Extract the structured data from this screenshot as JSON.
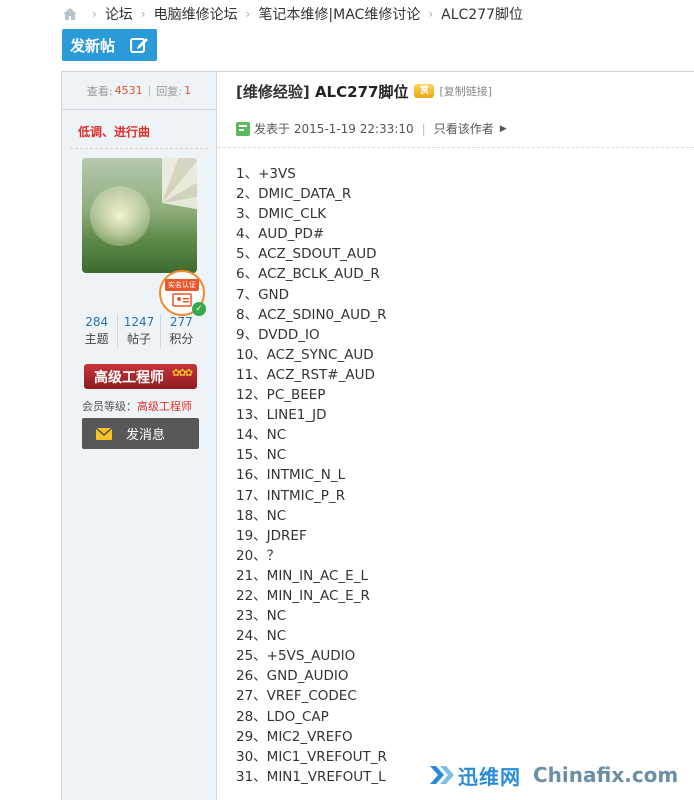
{
  "breadcrumb": {
    "items": [
      "论坛",
      "电脑维修论坛",
      "笔记本维修|MAC维修讨论",
      "ALC277脚位"
    ]
  },
  "toolbar": {
    "new_post_label": "发新帖"
  },
  "stats": {
    "views_label": "查看:",
    "views": "4531",
    "replies_label": "回复:",
    "replies": "1"
  },
  "author": {
    "name": "低调、进行曲",
    "cert_label": "实名认证",
    "counts": [
      {
        "value": "284",
        "label": "主题"
      },
      {
        "value": "1247",
        "label": "帖子"
      },
      {
        "value": "277",
        "label": "积分"
      }
    ],
    "rank": "高级工程师",
    "member_level_label": "会员等级：",
    "member_level": "高级工程师",
    "message_label": "发消息"
  },
  "post": {
    "category": "[维修经验]",
    "title": "ALC277脚位",
    "coin_icon_text": "赏",
    "copy_link": "[复制链接]",
    "posted_at": "发表于 2015-1-19 22:33:10",
    "author_only": "只看该作者",
    "pins": [
      "1、+3VS",
      "2、DMIC_DATA_R",
      "3、DMIC_CLK",
      "4、AUD_PD#",
      "5、ACZ_SDOUT_AUD",
      "6、ACZ_BCLK_AUD_R",
      "7、GND",
      "8、ACZ_SDIN0_AUD_R",
      "9、DVDD_IO",
      "10、ACZ_SYNC_AUD",
      "11、ACZ_RST#_AUD",
      "12、PC_BEEP",
      "13、LINE1_JD",
      "14、NC",
      "15、NC",
      "16、INTMIC_N_L",
      "17、INTMIC_P_R",
      "18、NC",
      "19、JDREF",
      "20、？",
      "21、MIN_IN_AC_E_L",
      "22、MIN_IN_AC_E_R",
      "23、NC",
      "24、NC",
      "25、+5VS_AUDIO",
      "26、GND_AUDIO",
      "27、VREF_CODEC",
      "28、LDO_CAP",
      "29、MIC2_VREFO",
      "30、MIC1_VREFOUT_R",
      "31、MIN1_VREFOUT_L"
    ]
  },
  "watermark": {
    "cn": "迅维网",
    "en": "Chinafix.com"
  },
  "colors": {
    "accent": "#2a9ad8",
    "author_red": "#e0302b",
    "sidebar_bg": "#eef3f7"
  }
}
